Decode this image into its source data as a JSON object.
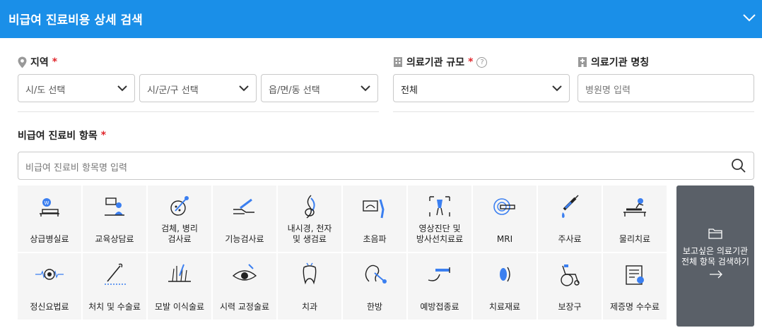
{
  "header": {
    "title": "비급여 진료비용 상세 검색"
  },
  "region": {
    "label": "지역",
    "required": "*",
    "sido": "시/도 선택",
    "sigungu": "시/군/구 선택",
    "eupmyeon": "읍/면/동 선택"
  },
  "scale": {
    "label": "의료기관 규모",
    "required": "*",
    "help": "?",
    "value": "전체"
  },
  "hospital_name": {
    "label": "의료기관 명칭",
    "placeholder": "병원명 입력"
  },
  "items": {
    "label": "비급여 진료비 항목",
    "required": "*",
    "placeholder": "비급여 진료비 항목명 입력"
  },
  "categories": [
    {
      "label": "상급병실료",
      "icon": "hospital-bed-icon"
    },
    {
      "label": "교육상담료",
      "icon": "counseling-icon"
    },
    {
      "label": "검체, 병리\n검사료",
      "icon": "pathology-icon"
    },
    {
      "label": "기능검사료",
      "icon": "function-test-icon"
    },
    {
      "label": "내시경, 천자\n및 생검료",
      "icon": "endoscope-icon"
    },
    {
      "label": "초음파",
      "icon": "ultrasound-icon"
    },
    {
      "label": "영상진단 및\n방사선치료료",
      "icon": "radiology-icon"
    },
    {
      "label": "MRI",
      "icon": "mri-icon"
    },
    {
      "label": "주사료",
      "icon": "syringe-icon"
    },
    {
      "label": "물리치료",
      "icon": "physical-therapy-icon"
    },
    {
      "label": "정신요법료",
      "icon": "brain-wave-icon"
    },
    {
      "label": "처치 및 수술료",
      "icon": "surgery-icon"
    },
    {
      "label": "모발 이식술료",
      "icon": "hair-transplant-icon"
    },
    {
      "label": "시력 교정술료",
      "icon": "eye-icon"
    },
    {
      "label": "치과",
      "icon": "tooth-icon"
    },
    {
      "label": "한방",
      "icon": "oriental-medicine-icon"
    },
    {
      "label": "예방접종료",
      "icon": "vaccine-icon"
    },
    {
      "label": "치료재료",
      "icon": "lens-icon"
    },
    {
      "label": "보장구",
      "icon": "wheelchair-icon"
    },
    {
      "label": "제증명 수수료",
      "icon": "certificate-icon"
    }
  ],
  "all_search": {
    "label": "보고싶은 의료기관\n전체 항목 검색하기",
    "icon": "folder-icon",
    "arrow": "→"
  },
  "colors": {
    "header": "#1a8fe8",
    "accent": "#3b7ff0",
    "required": "#e0252b",
    "side_button": "#5a6068"
  }
}
